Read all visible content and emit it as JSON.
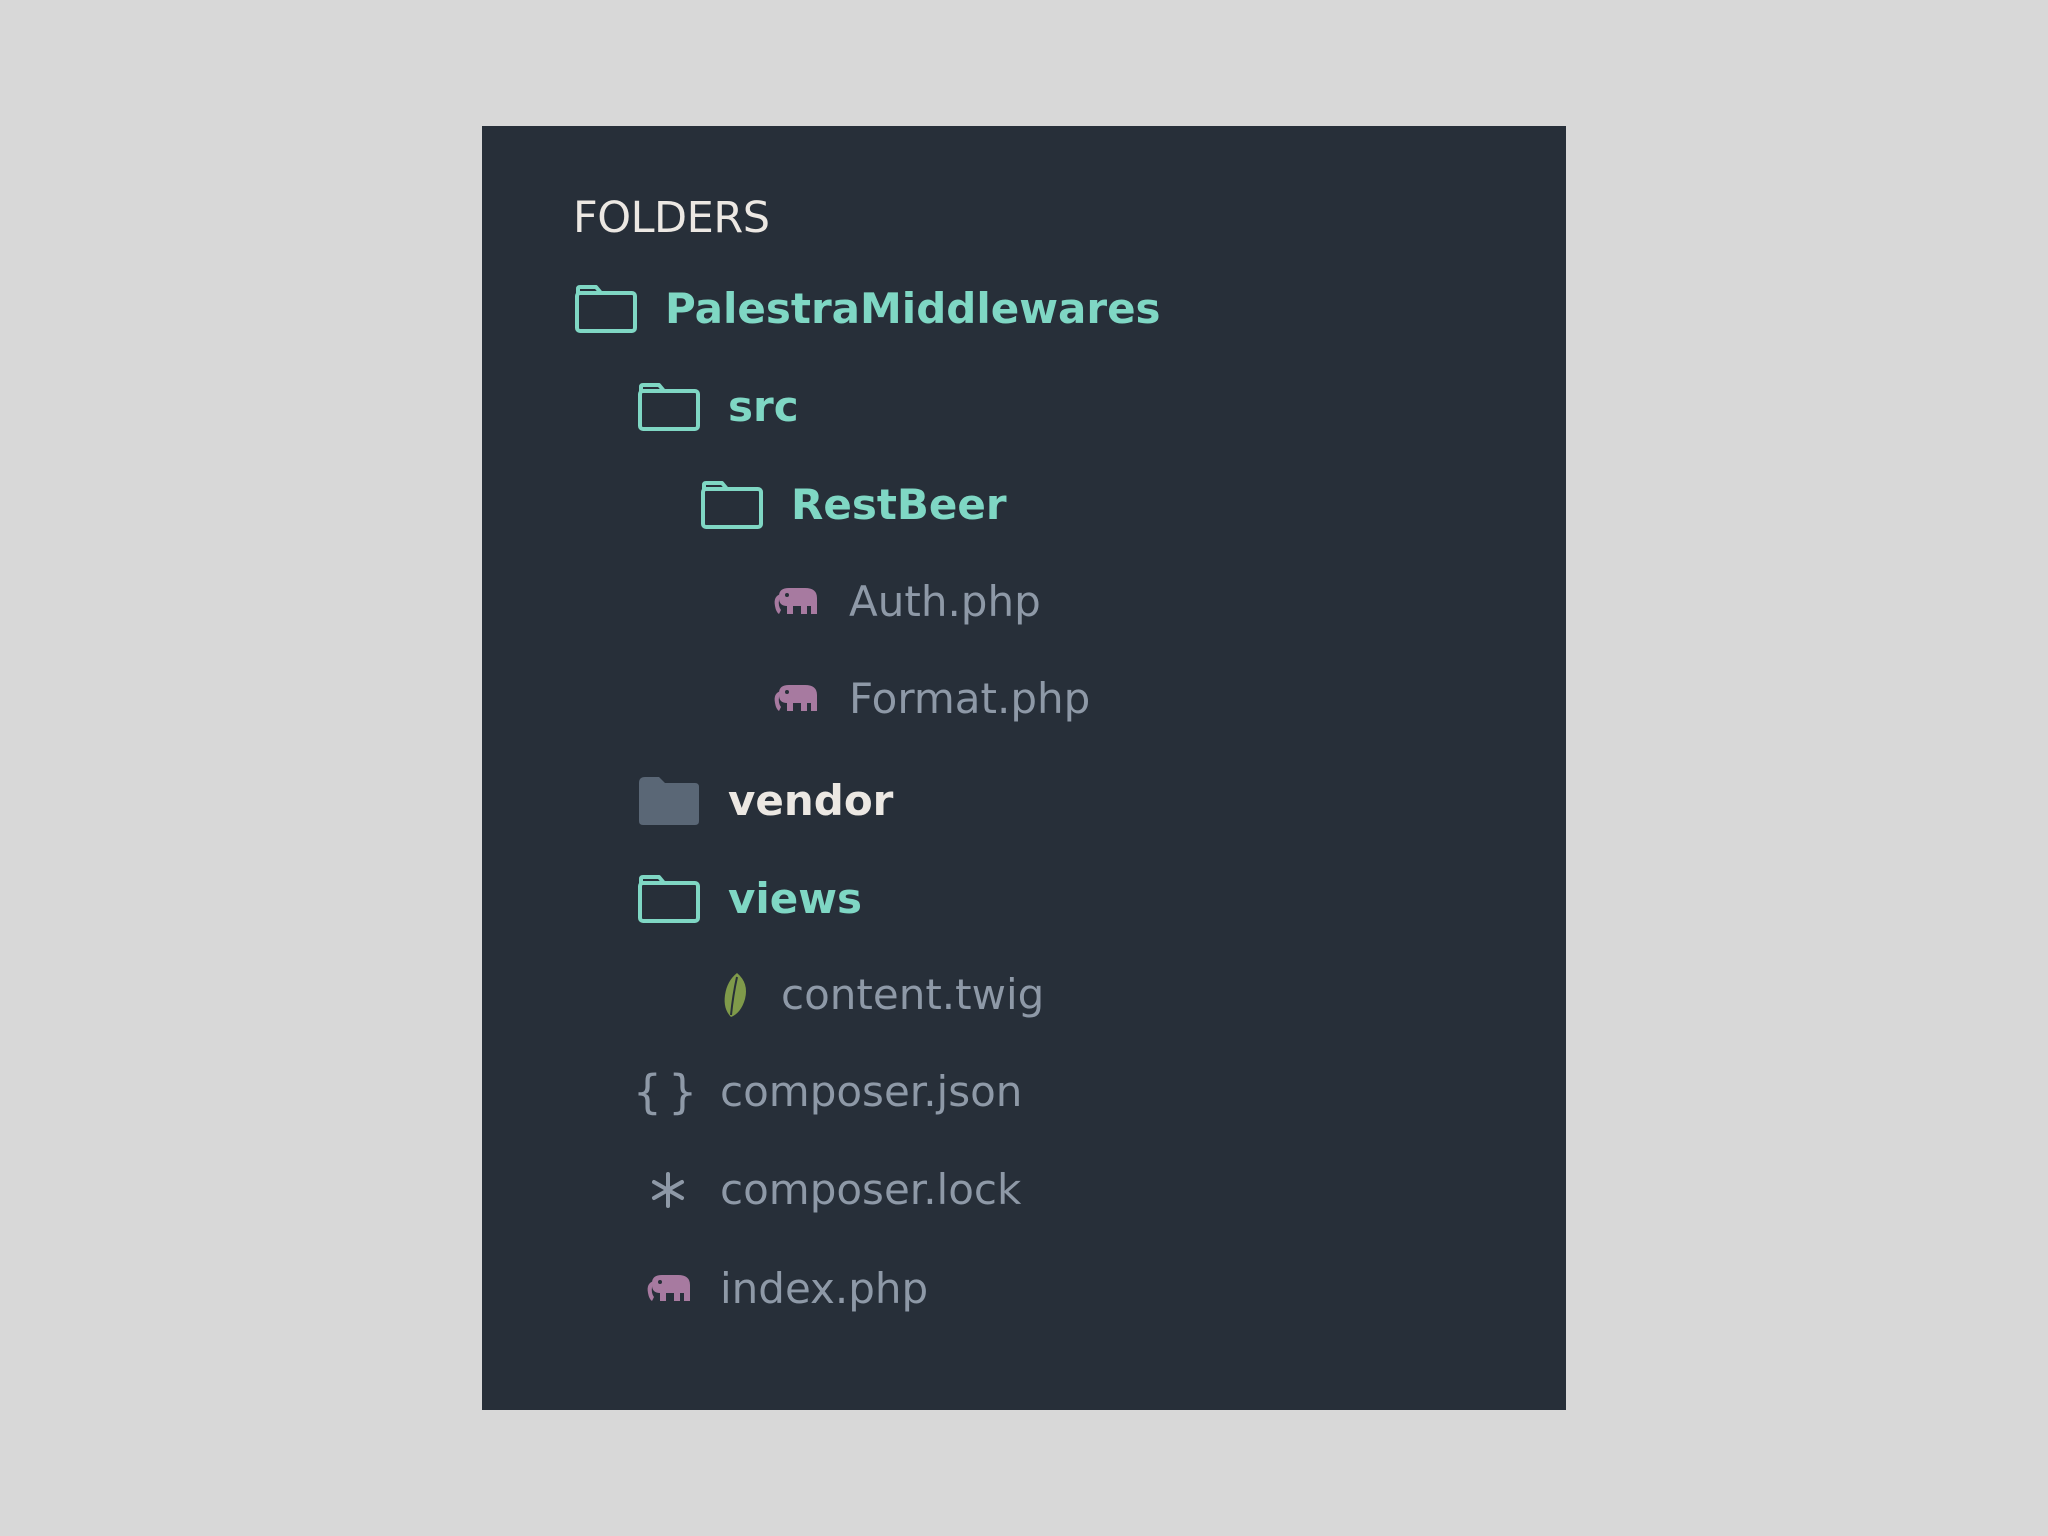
{
  "sidebar": {
    "header": "FOLDERS",
    "tree": [
      {
        "label": "PalestraMiddlewares",
        "type": "folder-open",
        "icon": "folder-outline-icon"
      },
      {
        "label": "src",
        "type": "folder-open",
        "icon": "folder-outline-icon"
      },
      {
        "label": "RestBeer",
        "type": "folder-open",
        "icon": "folder-outline-icon"
      },
      {
        "label": "Auth.php",
        "type": "file",
        "icon": "php-elephant-icon"
      },
      {
        "label": "Format.php",
        "type": "file",
        "icon": "php-elephant-icon"
      },
      {
        "label": "vendor",
        "type": "folder-closed",
        "icon": "folder-filled-icon"
      },
      {
        "label": "views",
        "type": "folder-open",
        "icon": "folder-outline-icon"
      },
      {
        "label": "content.twig",
        "type": "file",
        "icon": "twig-leaf-icon"
      },
      {
        "label": "composer.json",
        "type": "file",
        "icon": "json-braces-icon"
      },
      {
        "label": "composer.lock",
        "type": "file",
        "icon": "asterisk-icon"
      },
      {
        "label": "index.php",
        "type": "file",
        "icon": "php-elephant-icon"
      }
    ]
  },
  "colors": {
    "background": "#d8d8d8",
    "panel": "#272f39",
    "folder_label": "#7fd7c4",
    "file_label": "#8e99a7",
    "header": "#ece8e3",
    "php_icon": "#a77aa0",
    "twig_icon": "#7f9a4a"
  }
}
